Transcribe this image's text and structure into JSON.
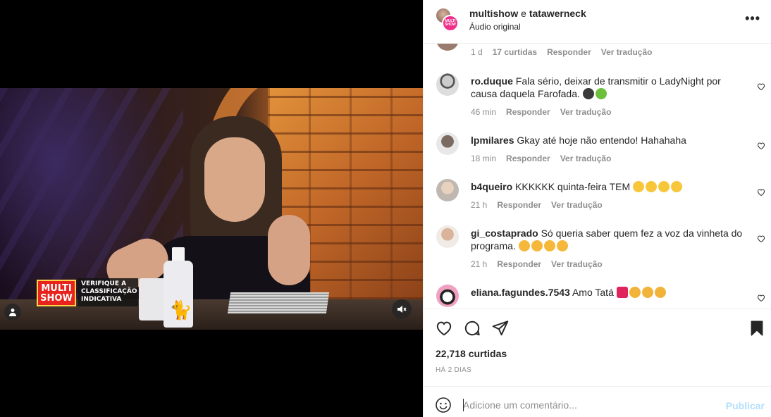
{
  "post": {
    "author_1": "multishow",
    "separator": "e",
    "author_2": "tatawerneck",
    "audio": "Áudio original",
    "badge_text": "MULTI SHOW"
  },
  "video": {
    "logo_text": "MULTI SHOW",
    "rating_text": "VERIFIQUE A CLASSIFICAÇÃO INDICATIVA"
  },
  "previous_comment": {
    "time": "1 d",
    "likes": "17 curtidas",
    "reply": "Responder",
    "translate": "Ver tradução"
  },
  "comments": [
    {
      "user": "ro.duque",
      "text": "Fala sério, deixar de transmitir o LadyNight por causa daquela Farofada.",
      "emojis": [
        "bomb",
        "nauseated-face"
      ],
      "time": "46 min",
      "reply": "Responder",
      "translate": "Ver tradução"
    },
    {
      "user": "lpmilares",
      "text": "Gkay até hoje não entendo! Hahahaha",
      "emojis": [],
      "time": "18 min",
      "reply": "Responder",
      "translate": "Ver tradução"
    },
    {
      "user": "b4queiro",
      "text": "KKKKKK quinta-feira TEM",
      "emojis": [
        "grinning-sweat",
        "grinning-sweat",
        "grinning-sweat",
        "grinning-sweat"
      ],
      "time": "21 h",
      "reply": "Responder",
      "translate": "Ver tradução"
    },
    {
      "user": "gi_costaprado",
      "text": "Só queria saber quem fez a voz da vinheta do programa.",
      "emojis": [
        "smirk",
        "smirk",
        "smirk",
        "smirk"
      ],
      "time": "21 h",
      "reply": "Responder",
      "translate": "Ver tradução"
    },
    {
      "user": "eliana.fagundes.7543",
      "text": "Amo Tatá",
      "emojis": [
        "red-heart",
        "clapping-hands",
        "clapping-hands",
        "clapping-hands"
      ],
      "time": "",
      "reply": "",
      "translate": ""
    }
  ],
  "stats": {
    "likes": "22,718 curtidas",
    "posted": "HÁ 2 DIAS"
  },
  "add_comment": {
    "placeholder": "Adicione um comentário...",
    "publish": "Publicar"
  },
  "icons": {
    "like": "heart-icon",
    "comment": "comment-icon",
    "share": "send-icon",
    "save": "bookmark-icon",
    "emoji": "emoji-icon",
    "mute": "muted-speaker-icon",
    "tag": "user-tag-icon",
    "more": "more-icon"
  },
  "colors": {
    "text": "#262626",
    "muted": "#8e8e8e",
    "publish_disabled": "#b2dffc",
    "divider": "#efefef"
  }
}
